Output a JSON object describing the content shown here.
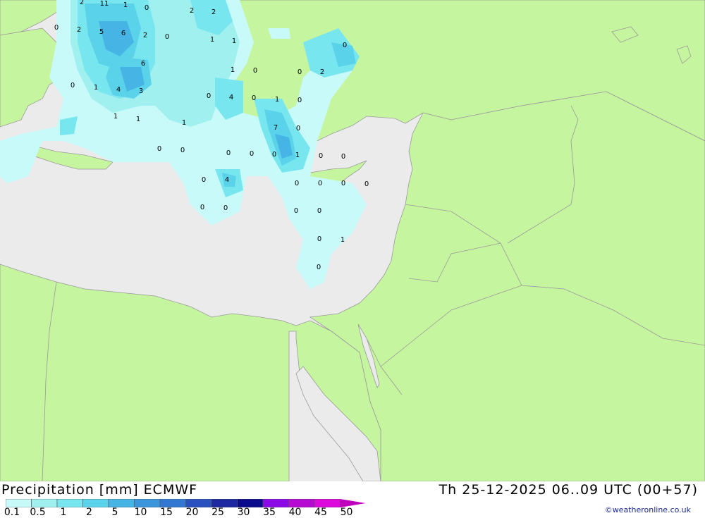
{
  "header": {
    "product": "Precipitation [mm] ECMWF",
    "valid_time": "Th 25-12-2025 06..09 UTC (00+57)"
  },
  "legend": {
    "ticks": [
      "0.1",
      "0.5",
      "1",
      "2",
      "5",
      "10",
      "15",
      "20",
      "25",
      "30",
      "35",
      "40",
      "45",
      "50"
    ],
    "colors": [
      "#c8fafa",
      "#a0f0f0",
      "#78e6ef",
      "#5ad2ea",
      "#46b4e4",
      "#3c96dc",
      "#3278d2",
      "#2850be",
      "#1e28a0",
      "#0a0a8c",
      "#8c0ae6",
      "#b40ad2",
      "#dc0adc",
      "#be00be"
    ]
  },
  "colors": {
    "land": "#c6f59f",
    "sea": "#ebebeb",
    "border": "#9a9a9a"
  },
  "credit": "©weatheronline.co.uk",
  "values": [
    "2",
    "11",
    "1",
    "0",
    "2",
    "2",
    "0",
    "2",
    "5",
    "6",
    "2",
    "0",
    "1",
    "1",
    "0",
    "6",
    "1",
    "0",
    "0",
    "2",
    "0",
    "1",
    "4",
    "3",
    "0",
    "4",
    "0",
    "1",
    "0",
    "1",
    "1",
    "1",
    "7",
    "0",
    "0",
    "0",
    "0",
    "0",
    "0",
    "1",
    "0",
    "0",
    "0",
    "4",
    "0",
    "0",
    "0",
    "0",
    "0",
    "0",
    "0",
    "0",
    "0",
    "1",
    "0"
  ]
}
